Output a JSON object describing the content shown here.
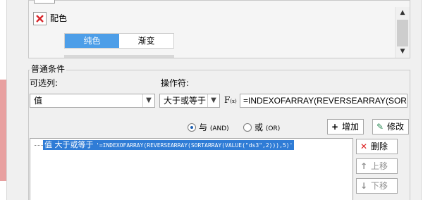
{
  "color_section": {
    "label": "配色",
    "tabs": [
      "纯色",
      "渐变"
    ],
    "selected_tab": "纯色",
    "accent_color": "#4d9ee8"
  },
  "conditions": {
    "group_title": "普通条件",
    "optional_label": "可选列:",
    "operator_label": "操作符:",
    "value_selected": "值",
    "operator_selected": "大于或等于",
    "fx_label": "F",
    "fx_sub": "(x)",
    "formula": "=INDEXOFARRAY(REVERSEARRAY(SORTARRAY(VALUE(\"ds3\",2)),5)",
    "and_label": "与",
    "and_sub": "(AND)",
    "or_label": "或",
    "or_sub": "(OR)",
    "and_selected": true
  },
  "buttons": {
    "add": "增加",
    "modify": "修改",
    "delete": "删除",
    "move_up": "上移",
    "move_down": "下移"
  },
  "condition_list": {
    "items": [
      {
        "prefix": "值 大于或等于 ",
        "formula": "'=INDEXOFARRAY(REVERSEARRAY(SORTARRAY(VALUE(\"ds3\",2))),5)'"
      }
    ],
    "selection_color": "#2f7cd6"
  },
  "icons": {
    "remove": "red-x-icon",
    "add": "plus-icon",
    "modify": "edit-icon",
    "delete": "red-x-icon",
    "up": "arrow-up-icon",
    "down": "arrow-down-icon"
  }
}
